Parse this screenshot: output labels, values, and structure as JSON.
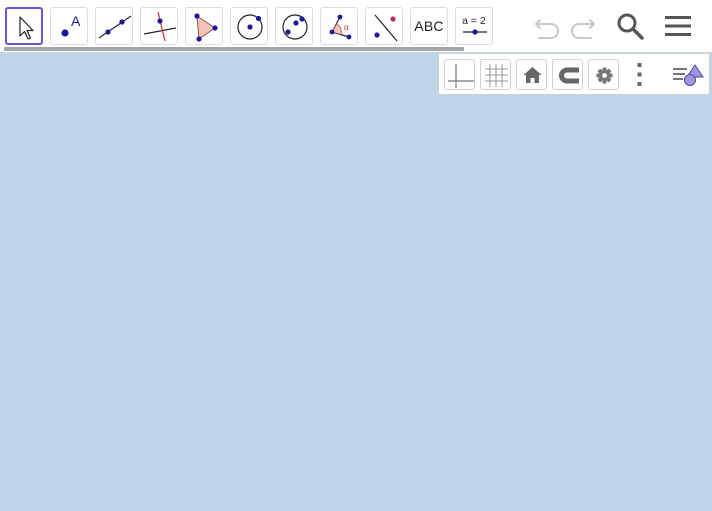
{
  "toolbar": {
    "tools": [
      {
        "name": "move-tool",
        "text": ""
      },
      {
        "name": "point-tool",
        "text": "A"
      },
      {
        "name": "line-tool",
        "text": ""
      },
      {
        "name": "perpendicular-line-tool",
        "text": ""
      },
      {
        "name": "polygon-tool",
        "text": ""
      },
      {
        "name": "circle-center-point-tool",
        "text": ""
      },
      {
        "name": "circle-three-points-tool",
        "text": ""
      },
      {
        "name": "angle-tool",
        "text": "α"
      },
      {
        "name": "reflect-about-line-tool",
        "text": ""
      },
      {
        "name": "text-tool",
        "text": "ABC"
      },
      {
        "name": "slider-tool",
        "text": "a = 2"
      }
    ],
    "icons": {
      "undo": "undo-icon",
      "redo": "redo-icon",
      "search": "search-icon",
      "menu": "hamburger-menu-icon"
    }
  },
  "style_bar": {
    "icons": [
      "axes-icon",
      "grid-icon",
      "home-icon",
      "magnet-icon",
      "gear-icon",
      "more-vertical-icon",
      "style-bar-toggle-icon"
    ]
  },
  "colors": {
    "graphics_background": "#bed4e8",
    "accent": "#6557d2",
    "point": "#1a1aa0",
    "polygon_fill": "#f4c2b8",
    "red_line": "#d03030"
  }
}
